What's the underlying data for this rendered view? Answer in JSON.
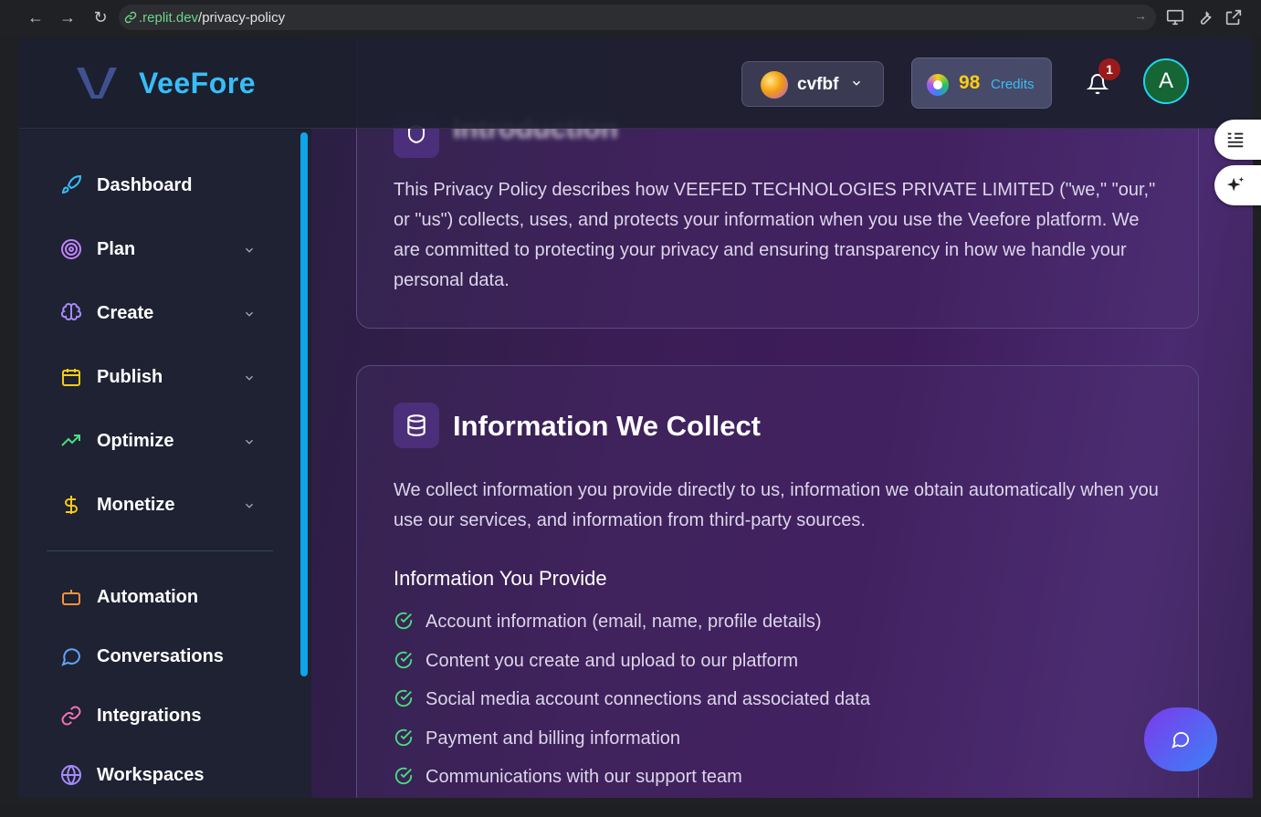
{
  "browser": {
    "url_host": ".replit.dev",
    "url_path": "/privacy-policy"
  },
  "header": {
    "logo_text": "VeeFore",
    "workspace_name": "cvfbf",
    "credits_value": "98",
    "credits_label": "Credits",
    "notification_count": "1",
    "avatar_initial": "A"
  },
  "sidebar": {
    "items": [
      {
        "label": "Dashboard",
        "icon": "rocket-icon",
        "color": "#38bdf8"
      },
      {
        "label": "Plan",
        "icon": "target-icon",
        "color": "#c084fc"
      },
      {
        "label": "Create",
        "icon": "brain-icon",
        "color": "#a78bfa"
      },
      {
        "label": "Publish",
        "icon": "calendar-icon",
        "color": "#facc15"
      },
      {
        "label": "Optimize",
        "icon": "trending-up-icon",
        "color": "#4ade80"
      },
      {
        "label": "Monetize",
        "icon": "dollar-icon",
        "color": "#facc15"
      },
      {
        "label": "Automation",
        "icon": "bot-icon",
        "color": "#fb923c"
      },
      {
        "label": "Conversations",
        "icon": "message-circle-icon",
        "color": "#60a5fa"
      },
      {
        "label": "Integrations",
        "icon": "link-icon",
        "color": "#f472b6"
      },
      {
        "label": "Workspaces",
        "icon": "globe-icon",
        "color": "#a78bfa"
      }
    ]
  },
  "main": {
    "intro": {
      "title": "Introduction",
      "text": "This Privacy Policy describes how VEEFED TECHNOLOGIES PRIVATE LIMITED (\"we,\" \"our,\" or \"us\") collects, uses, and protects your information when you use the Veefore platform. We are committed to protecting your privacy and ensuring transparency in how we handle your personal data."
    },
    "collect": {
      "title": "Information We Collect",
      "text": "We collect information you provide directly to us, information we obtain automatically when you use our services, and information from third-party sources.",
      "subtitle": "Information You Provide",
      "items": [
        "Account information (email, name, profile details)",
        "Content you create and upload to our platform",
        "Social media account connections and associated data",
        "Payment and billing information",
        "Communications with our support team"
      ]
    }
  }
}
